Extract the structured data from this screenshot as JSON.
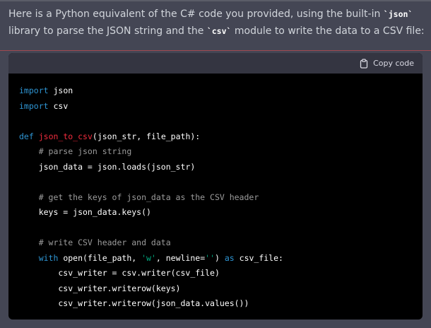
{
  "message": {
    "intro_text_1": "Here is a Python equivalent of the C# code you provided, using the built-in ",
    "lib1": "`json`",
    "intro_text_2": " library to parse the JSON string and the ",
    "lib2": "`csv`",
    "intro_text_3": " module to write the data to a CSV file:"
  },
  "code_block": {
    "copy_label": "Copy code",
    "copy_icon": "clipboard-icon",
    "language": "python"
  },
  "code": {
    "l1_kw": "import",
    "l1_rest": " json",
    "l2_kw": "import",
    "l2_rest": " csv",
    "l4_kw": "def",
    "l4_sp": " ",
    "l4_fn": "json_to_csv",
    "l4_rest": "(json_str, file_path):",
    "l5": "    # parse json string",
    "l6": "    json_data = json.loads(json_str)",
    "l8": "    # get the keys of json_data as the CSV header",
    "l9": "    keys = json_data.keys()",
    "l11": "    # write CSV header and data",
    "l12_indent": "    ",
    "l12_kw": "with",
    "l12_a": " open(file_path, ",
    "l12_s1": "'w'",
    "l12_b": ", newline=",
    "l12_s2": "''",
    "l12_c": ") ",
    "l12_kw2": "as",
    "l12_d": " csv_file:",
    "l13": "        csv_writer = csv.writer(csv_file)",
    "l14": "        csv_writer.writerow(keys)",
    "l15": "        csv_writer.writerow(json_data.values())"
  }
}
